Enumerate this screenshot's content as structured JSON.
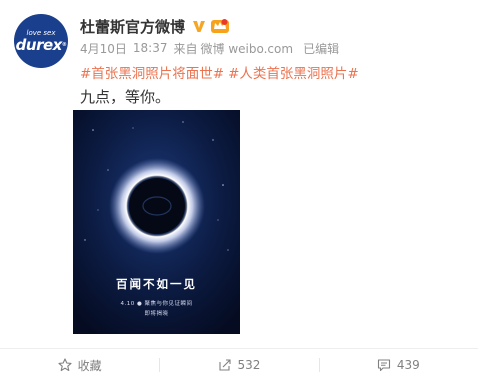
{
  "post": {
    "avatar": {
      "tagline": "love sex",
      "logo": "durex",
      "tm": "®"
    },
    "username": "杜蕾斯官方微博",
    "date": "4月10日",
    "time": "18:37",
    "from_label": "来自",
    "source": "微博 weibo.com",
    "edited": "已编辑",
    "hashtags": [
      "#首张黑洞照片将面世#",
      "#人类首张黑洞照片#"
    ],
    "text": "九点，等你。",
    "poster": {
      "headline": "百闻不如一见",
      "sub1": "4.10 ● 聚焦与你见证瞬间",
      "sub2": "即将揭晓"
    }
  },
  "actions": {
    "favorite": "收藏",
    "repost_count": "532",
    "comment_count": "439"
  },
  "colors": {
    "hashtag": "#eb7350",
    "verified": "#f5a623",
    "brand_blue": "#1a3f8c"
  }
}
